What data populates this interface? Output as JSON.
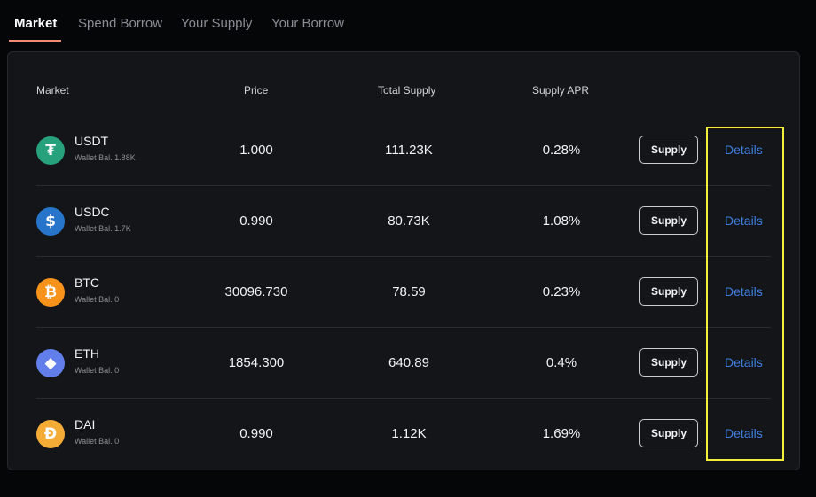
{
  "tabs": [
    {
      "label": "Market",
      "active": true
    },
    {
      "label": "Spend Borrow",
      "active": false
    },
    {
      "label": "Your Supply",
      "active": false
    },
    {
      "label": "Your Borrow",
      "active": false
    }
  ],
  "table": {
    "headers": {
      "market": "Market",
      "price": "Price",
      "total_supply": "Total Supply",
      "supply_apr": "Supply APR"
    },
    "rows": [
      {
        "symbol": "USDT",
        "wallet": "Wallet Bal. 1.88K",
        "price": "1.000",
        "total_supply": "111.23K",
        "apr": "0.28%",
        "supply_label": "Supply",
        "details_label": "Details",
        "icon": "tether-icon",
        "icon_glyph": "₮",
        "color": "#26a17b"
      },
      {
        "symbol": "USDC",
        "wallet": "Wallet Bal. 1.7K",
        "price": "0.990",
        "total_supply": "80.73K",
        "apr": "1.08%",
        "supply_label": "Supply",
        "details_label": "Details",
        "icon": "usdc-icon",
        "icon_glyph": "$",
        "color": "#2775ca"
      },
      {
        "symbol": "BTC",
        "wallet": "Wallet Bal. 0",
        "price": "30096.730",
        "total_supply": "78.59",
        "apr": "0.23%",
        "supply_label": "Supply",
        "details_label": "Details",
        "icon": "bitcoin-icon",
        "icon_glyph": "₿",
        "color": "#f7931a"
      },
      {
        "symbol": "ETH",
        "wallet": "Wallet Bal. 0",
        "price": "1854.300",
        "total_supply": "640.89",
        "apr": "0.4%",
        "supply_label": "Supply",
        "details_label": "Details",
        "icon": "ethereum-icon",
        "icon_glyph": "◆",
        "color": "#627eea"
      },
      {
        "symbol": "DAI",
        "wallet": "Wallet Bal. 0",
        "price": "0.990",
        "total_supply": "1.12K",
        "apr": "1.69%",
        "supply_label": "Supply",
        "details_label": "Details",
        "icon": "dai-icon",
        "icon_glyph": "Đ",
        "color": "#f5ac37"
      }
    ]
  },
  "colors": {
    "accent_underline": "#f08a72",
    "details_link": "#3d7fe0",
    "highlight_box": "#f2ee3a"
  }
}
